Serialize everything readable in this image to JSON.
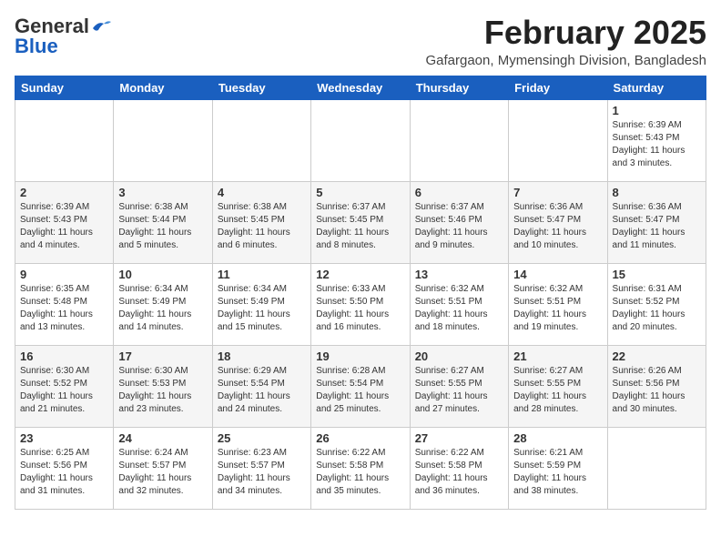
{
  "header": {
    "logo_general": "General",
    "logo_blue": "Blue",
    "month_title": "February 2025",
    "location": "Gafargaon, Mymensingh Division, Bangladesh"
  },
  "weekdays": [
    "Sunday",
    "Monday",
    "Tuesday",
    "Wednesday",
    "Thursday",
    "Friday",
    "Saturday"
  ],
  "weeks": [
    [
      {
        "day": "",
        "info": ""
      },
      {
        "day": "",
        "info": ""
      },
      {
        "day": "",
        "info": ""
      },
      {
        "day": "",
        "info": ""
      },
      {
        "day": "",
        "info": ""
      },
      {
        "day": "",
        "info": ""
      },
      {
        "day": "1",
        "info": "Sunrise: 6:39 AM\nSunset: 5:43 PM\nDaylight: 11 hours\nand 3 minutes."
      }
    ],
    [
      {
        "day": "2",
        "info": "Sunrise: 6:39 AM\nSunset: 5:43 PM\nDaylight: 11 hours\nand 4 minutes."
      },
      {
        "day": "3",
        "info": "Sunrise: 6:38 AM\nSunset: 5:44 PM\nDaylight: 11 hours\nand 5 minutes."
      },
      {
        "day": "4",
        "info": "Sunrise: 6:38 AM\nSunset: 5:45 PM\nDaylight: 11 hours\nand 6 minutes."
      },
      {
        "day": "5",
        "info": "Sunrise: 6:37 AM\nSunset: 5:45 PM\nDaylight: 11 hours\nand 8 minutes."
      },
      {
        "day": "6",
        "info": "Sunrise: 6:37 AM\nSunset: 5:46 PM\nDaylight: 11 hours\nand 9 minutes."
      },
      {
        "day": "7",
        "info": "Sunrise: 6:36 AM\nSunset: 5:47 PM\nDaylight: 11 hours\nand 10 minutes."
      },
      {
        "day": "8",
        "info": "Sunrise: 6:36 AM\nSunset: 5:47 PM\nDaylight: 11 hours\nand 11 minutes."
      }
    ],
    [
      {
        "day": "9",
        "info": "Sunrise: 6:35 AM\nSunset: 5:48 PM\nDaylight: 11 hours\nand 13 minutes."
      },
      {
        "day": "10",
        "info": "Sunrise: 6:34 AM\nSunset: 5:49 PM\nDaylight: 11 hours\nand 14 minutes."
      },
      {
        "day": "11",
        "info": "Sunrise: 6:34 AM\nSunset: 5:49 PM\nDaylight: 11 hours\nand 15 minutes."
      },
      {
        "day": "12",
        "info": "Sunrise: 6:33 AM\nSunset: 5:50 PM\nDaylight: 11 hours\nand 16 minutes."
      },
      {
        "day": "13",
        "info": "Sunrise: 6:32 AM\nSunset: 5:51 PM\nDaylight: 11 hours\nand 18 minutes."
      },
      {
        "day": "14",
        "info": "Sunrise: 6:32 AM\nSunset: 5:51 PM\nDaylight: 11 hours\nand 19 minutes."
      },
      {
        "day": "15",
        "info": "Sunrise: 6:31 AM\nSunset: 5:52 PM\nDaylight: 11 hours\nand 20 minutes."
      }
    ],
    [
      {
        "day": "16",
        "info": "Sunrise: 6:30 AM\nSunset: 5:52 PM\nDaylight: 11 hours\nand 21 minutes."
      },
      {
        "day": "17",
        "info": "Sunrise: 6:30 AM\nSunset: 5:53 PM\nDaylight: 11 hours\nand 23 minutes."
      },
      {
        "day": "18",
        "info": "Sunrise: 6:29 AM\nSunset: 5:54 PM\nDaylight: 11 hours\nand 24 minutes."
      },
      {
        "day": "19",
        "info": "Sunrise: 6:28 AM\nSunset: 5:54 PM\nDaylight: 11 hours\nand 25 minutes."
      },
      {
        "day": "20",
        "info": "Sunrise: 6:27 AM\nSunset: 5:55 PM\nDaylight: 11 hours\nand 27 minutes."
      },
      {
        "day": "21",
        "info": "Sunrise: 6:27 AM\nSunset: 5:55 PM\nDaylight: 11 hours\nand 28 minutes."
      },
      {
        "day": "22",
        "info": "Sunrise: 6:26 AM\nSunset: 5:56 PM\nDaylight: 11 hours\nand 30 minutes."
      }
    ],
    [
      {
        "day": "23",
        "info": "Sunrise: 6:25 AM\nSunset: 5:56 PM\nDaylight: 11 hours\nand 31 minutes."
      },
      {
        "day": "24",
        "info": "Sunrise: 6:24 AM\nSunset: 5:57 PM\nDaylight: 11 hours\nand 32 minutes."
      },
      {
        "day": "25",
        "info": "Sunrise: 6:23 AM\nSunset: 5:57 PM\nDaylight: 11 hours\nand 34 minutes."
      },
      {
        "day": "26",
        "info": "Sunrise: 6:22 AM\nSunset: 5:58 PM\nDaylight: 11 hours\nand 35 minutes."
      },
      {
        "day": "27",
        "info": "Sunrise: 6:22 AM\nSunset: 5:58 PM\nDaylight: 11 hours\nand 36 minutes."
      },
      {
        "day": "28",
        "info": "Sunrise: 6:21 AM\nSunset: 5:59 PM\nDaylight: 11 hours\nand 38 minutes."
      },
      {
        "day": "",
        "info": ""
      }
    ]
  ]
}
